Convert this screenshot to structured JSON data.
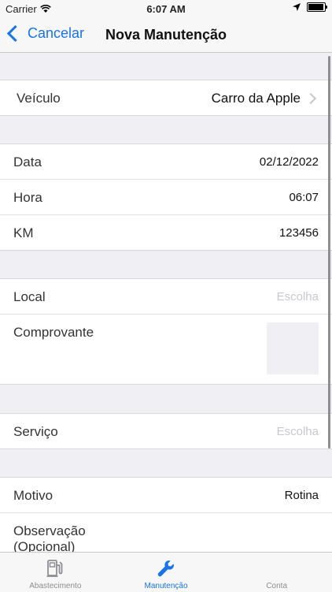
{
  "status": {
    "carrier": "Carrier",
    "time": "6:07 AM"
  },
  "nav": {
    "back_label": "Cancelar",
    "title": "Nova Manutenção"
  },
  "vehicle": {
    "label": "Veículo",
    "value": "Carro da Apple"
  },
  "details": [
    {
      "label": "Data",
      "value": "02/12/2022"
    },
    {
      "label": "Hora",
      "value": "06:07"
    },
    {
      "label": "KM",
      "value": "123456"
    }
  ],
  "place": {
    "local_label": "Local",
    "local_placeholder": "Escolha",
    "receipt_label": "Comprovante"
  },
  "service": {
    "label": "Serviço",
    "placeholder": "Escolha"
  },
  "reason": {
    "label": "Motivo",
    "value": "Rotina",
    "obs_label_line1": "Observação",
    "obs_label_line2": "(Opcional)"
  },
  "tabs": [
    {
      "label": "Abastecimento",
      "icon": "fuel-pump-icon"
    },
    {
      "label": "Manutenção",
      "icon": "wrench-icon",
      "active": true
    },
    {
      "label": "Conta",
      "icon": "account-icon"
    }
  ],
  "colors": {
    "accent": "#1a73e8",
    "background": "#efeff4"
  }
}
